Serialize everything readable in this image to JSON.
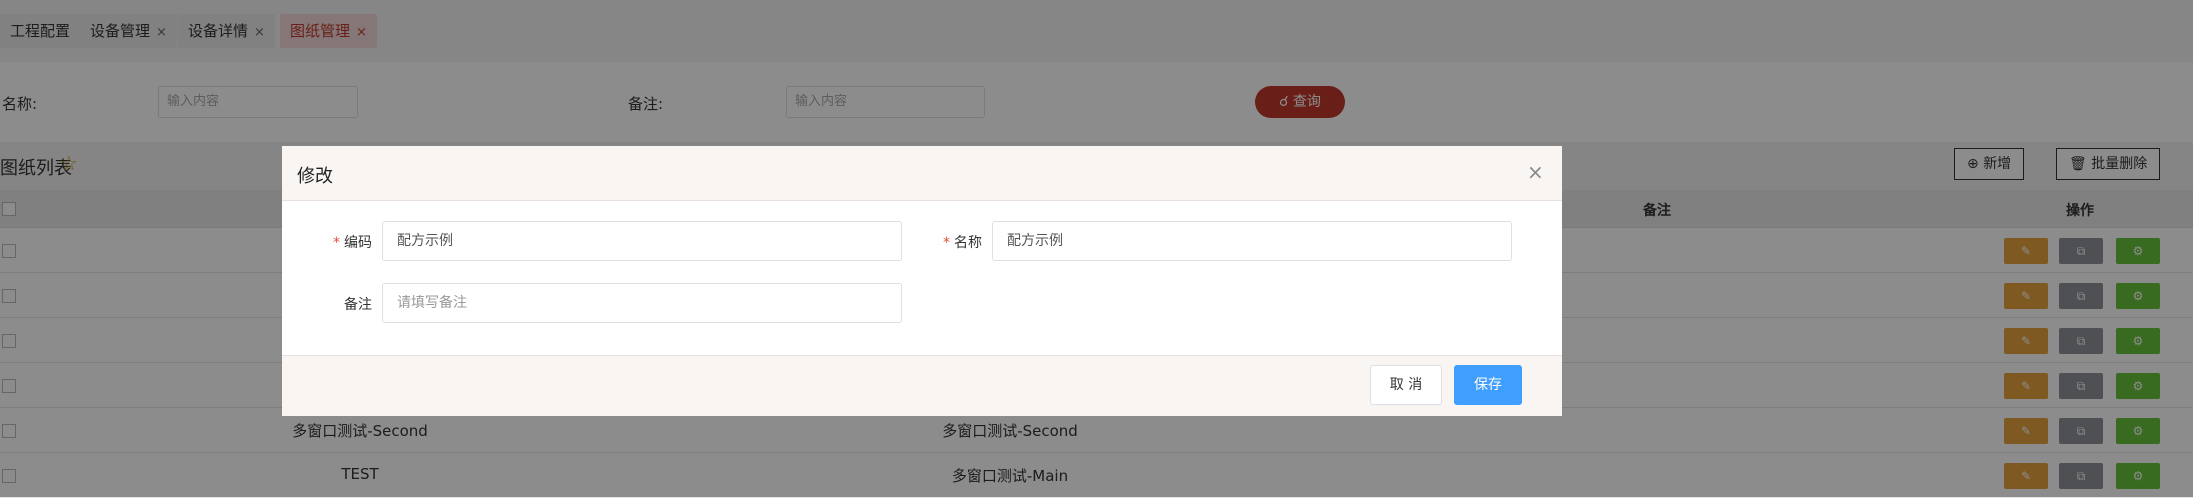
{
  "tabs": [
    {
      "label": "工程配置",
      "closable": false
    },
    {
      "label": "设备管理",
      "closable": true
    },
    {
      "label": "设备详情",
      "closable": true
    },
    {
      "label": "图纸管理",
      "closable": true,
      "active": true
    }
  ],
  "close_glyph": "×",
  "search": {
    "name_label": "名称:",
    "name_placeholder": "输入内容",
    "remark_label": "备注:",
    "remark_placeholder": "输入内容",
    "query_label": "查询"
  },
  "list": {
    "title": "图纸列表",
    "add_label": "新增",
    "batch_delete_label": "批量删除"
  },
  "table": {
    "columns": [
      "备注",
      "操作"
    ],
    "rows": [
      {
        "code": "",
        "name": ""
      },
      {
        "code": "",
        "name": ""
      },
      {
        "code": "",
        "name": ""
      },
      {
        "code": "",
        "name": ""
      },
      {
        "code": "多窗口测试-Second",
        "name": "多窗口测试-Second"
      },
      {
        "code": "TEST",
        "name": "多窗口测试-Main"
      }
    ]
  },
  "dialog": {
    "title": "修改",
    "required_mark": "*",
    "code_label": "编码",
    "code_value": "配方示例",
    "name_label": "名称",
    "name_value": "配方示例",
    "remark_label": "备注",
    "remark_placeholder": "请填写备注",
    "cancel_label": "取 消",
    "save_label": "保存"
  },
  "colors": {
    "accent_red": "#c0392b",
    "primary_blue": "#409eff",
    "edit_orange": "#e6a23c",
    "copy_gray": "#909399",
    "config_green": "#67c23a"
  }
}
